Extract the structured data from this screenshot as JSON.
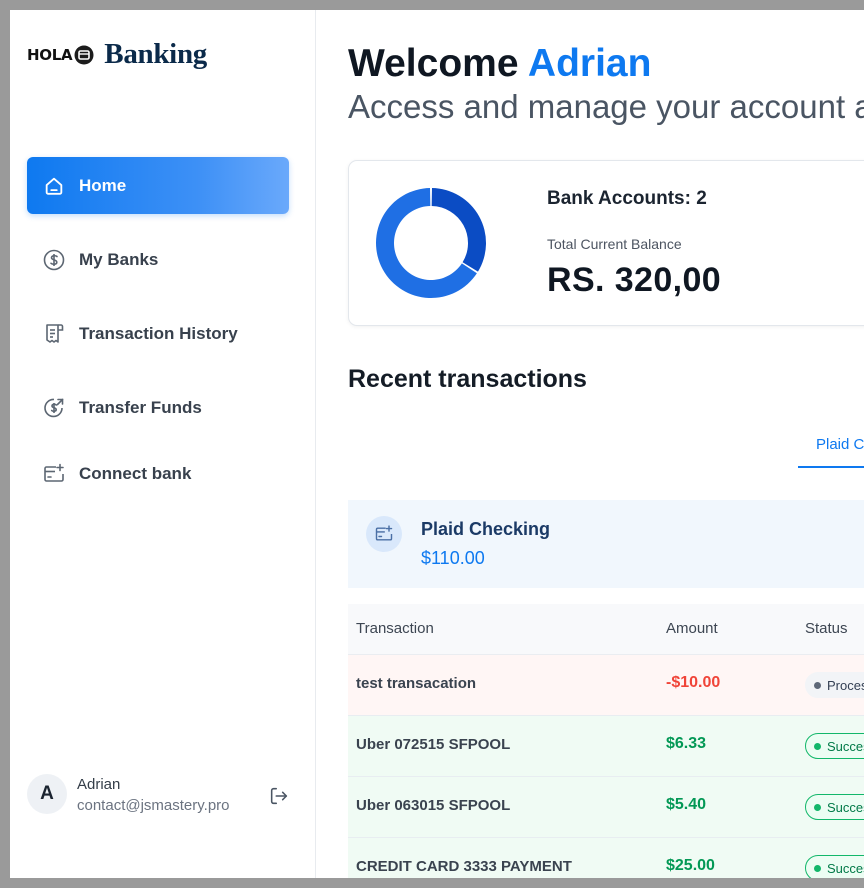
{
  "brand": {
    "mark": "HOLA",
    "name": "Banking"
  },
  "nav": {
    "items": [
      {
        "label": "Home",
        "icon": "home-icon",
        "active": true
      },
      {
        "label": "My Banks",
        "icon": "dollar-circle-icon",
        "active": false
      },
      {
        "label": "Transaction History",
        "icon": "receipt-icon",
        "active": false
      },
      {
        "label": "Transfer Funds",
        "icon": "money-send-icon",
        "active": false
      },
      {
        "label": "Connect bank",
        "icon": "connect-card-icon",
        "active": false
      }
    ]
  },
  "user": {
    "initial": "A",
    "name": "Adrian",
    "email": "contact@jsmastery.pro",
    "logout_icon": "logout-icon"
  },
  "header": {
    "greeting": "Welcome",
    "name": "Adrian",
    "subtitle": "Access and manage your account a"
  },
  "balance": {
    "accounts_label": "Bank Accounts: 2",
    "total_label": "Total Current Balance",
    "total_value": "RS. 320,00",
    "donut": {
      "segments": [
        {
          "value": 34,
          "color": "#0b4cc4"
        },
        {
          "value": 66,
          "color": "#1f6fe4"
        }
      ]
    }
  },
  "recent": {
    "title": "Recent transactions",
    "tab_label": "Plaid C",
    "bank": {
      "name": "Plaid Checking",
      "balance": "$110.00",
      "icon": "connect-card-icon"
    },
    "columns": [
      "Transaction",
      "Amount",
      "Status"
    ],
    "rows": [
      {
        "name": "test transacation",
        "amount": "-$10.00",
        "status": "Proces",
        "type": "neg",
        "status_kind": "processing"
      },
      {
        "name": "Uber 072515 SFPOOL",
        "amount": "$6.33",
        "status": "Succes",
        "type": "pos",
        "status_kind": "success"
      },
      {
        "name": "Uber 063015 SFPOOL",
        "amount": "$5.40",
        "status": "Succes",
        "type": "pos",
        "status_kind": "success"
      },
      {
        "name": "CREDIT CARD 3333 PAYMENT",
        "amount": "$25.00",
        "status": "Succes",
        "type": "pos",
        "status_kind": "success"
      }
    ]
  },
  "colors": {
    "accent": "#0e79f0",
    "negative": "#f04438",
    "positive": "#039855"
  }
}
